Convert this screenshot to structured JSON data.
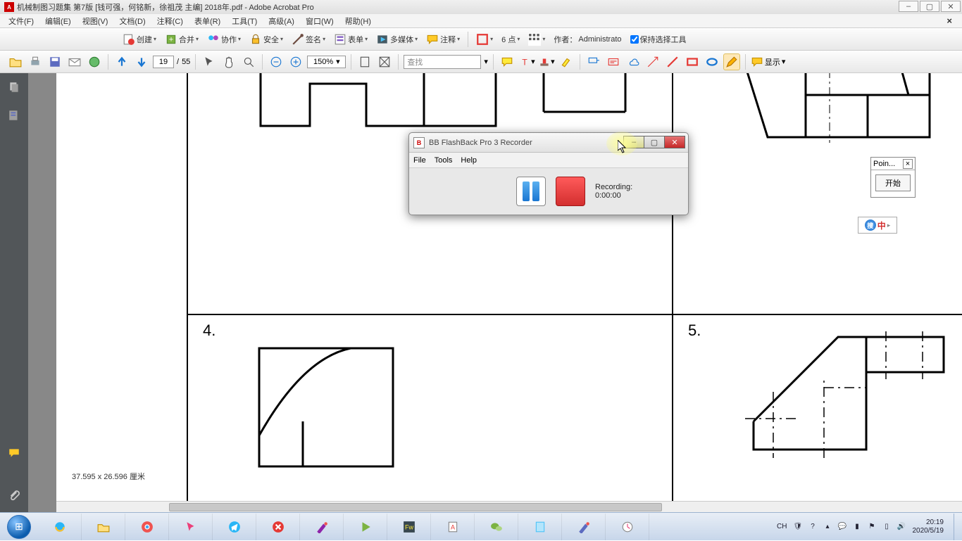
{
  "titlebar": {
    "title": "机械制图习题集 第7版 [钱可强，何铭新，徐祖茂 主编] 2018年.pdf - Adobe Acrobat Pro"
  },
  "menubar": {
    "items": [
      "文件(F)",
      "编辑(E)",
      "视图(V)",
      "文档(D)",
      "注释(C)",
      "表单(R)",
      "工具(T)",
      "高级(A)",
      "窗口(W)",
      "帮助(H)"
    ]
  },
  "toolbar1": {
    "create": "创建",
    "merge": "合并",
    "collab": "协作",
    "secure": "安全",
    "sign": "签名",
    "forms": "表单",
    "multimedia": "多媒体",
    "comment": "注释",
    "points": "6 点",
    "author_label": "作者：",
    "author": "Administrato",
    "keep_select": "保持选择工具"
  },
  "toolbar2": {
    "page_current": "19",
    "page_sep": "/",
    "page_total": "55",
    "zoom": "150%",
    "find_placeholder": "查找",
    "show": "显示"
  },
  "status": {
    "dimensions": "37.595 x 26.596 厘米"
  },
  "recorder": {
    "title": "BB FlashBack Pro 3 Recorder",
    "menu": [
      "File",
      "Tools",
      "Help"
    ],
    "recording_label": "Recording:",
    "time": "0:00:00"
  },
  "pointpanel": {
    "title": "Poin...",
    "close": "×",
    "button": "开始"
  },
  "ime": {
    "zh": "中"
  },
  "page_labels": {
    "four": "4.",
    "five": "5."
  },
  "tray": {
    "lang": "CH",
    "time": "20:19",
    "date": "2020/5/19"
  }
}
